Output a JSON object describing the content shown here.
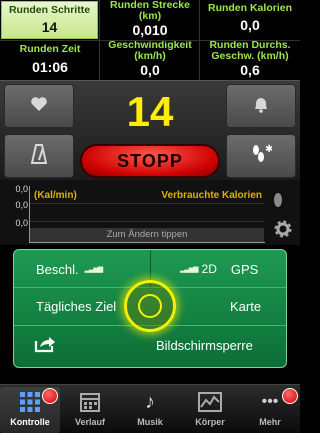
{
  "stats": [
    {
      "label": "Runden Schritte",
      "value": "14"
    },
    {
      "label": "Runden Strecke (km)",
      "value": "0,010"
    },
    {
      "label": "Runden Kalorien",
      "value": "0,0"
    },
    {
      "label": "Runden Zeit",
      "value": "01:06"
    },
    {
      "label": "Geschwindigkeit (km/h)",
      "value": "0,0"
    },
    {
      "label": "Runden Durchs. Geschw. (km/h)",
      "value": "0,6"
    }
  ],
  "counter": {
    "value": "14"
  },
  "stop_button": {
    "label": "STOPP"
  },
  "graph": {
    "y_ticks": [
      "0,0",
      "0,0",
      "0,0"
    ],
    "unit_label": "(Kal/min)",
    "series_label": "Verbrauchte Kalorien",
    "tap_hint": "Zum Ändern tippen"
  },
  "panel": {
    "accel_label": "Beschl.",
    "gps_mode": "2D",
    "gps_label": "GPS",
    "daily_goal_label": "Tägliches Ziel",
    "map_label": "Karte",
    "screen_lock_label": "Bildschirmsperre"
  },
  "tabs": [
    {
      "label": "Kontrolle",
      "icon": "grid-icon"
    },
    {
      "label": "Verlauf",
      "icon": "calendar-icon"
    },
    {
      "label": "Musik",
      "icon": "music-note-icon"
    },
    {
      "label": "Körper",
      "icon": "chart-icon"
    },
    {
      "label": "Mehr",
      "icon": "more-dots-icon"
    }
  ],
  "colors": {
    "label_green": "#9be84a",
    "counter_yellow": "#ffee00",
    "stop_red": "#cc0000",
    "panel_green": "#1e9a52",
    "graph_label": "#ddb300"
  }
}
